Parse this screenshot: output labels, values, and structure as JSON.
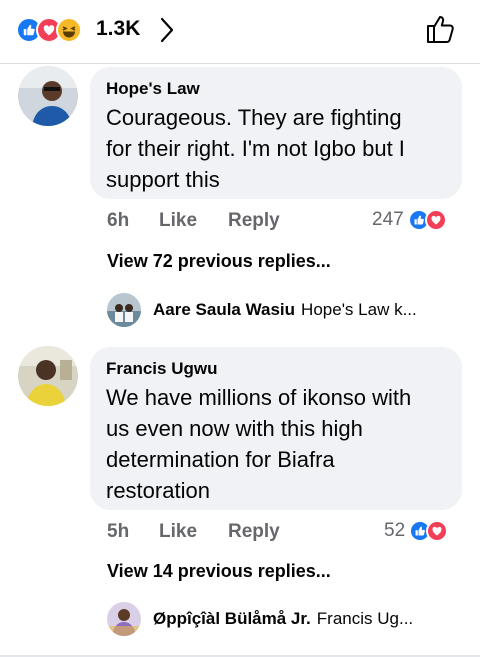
{
  "header": {
    "reaction_icons": [
      "like-icon",
      "love-icon",
      "haha-icon"
    ],
    "reaction_count": "1.3K",
    "chevron_icon": "chevron-right-icon",
    "like_button_icon": "thumbs-up-outline-icon"
  },
  "comments": [
    {
      "author": "Hope's Law",
      "text_lines": [
        "Courageous. They are fighting",
        "for their right.  I'm not Igbo but I",
        "support this"
      ],
      "time": "6h",
      "like_label": "Like",
      "reply_label": "Reply",
      "reaction_count": "247",
      "view_replies": "View 72 previous replies...",
      "reply_preview": {
        "author": "Aare Saula Wasiu",
        "text": "Hope's Law k..."
      }
    },
    {
      "author": "Francis Ugwu",
      "text_lines": [
        "We have millions of ikonso with",
        "us even now with this high",
        "determination for Biafra",
        "restoration"
      ],
      "time": "5h",
      "like_label": "Like",
      "reply_label": "Reply",
      "reaction_count": "52",
      "view_replies": "View 14 previous replies...",
      "reply_preview": {
        "author": "Øppîçîàl Bülåmå Jr.",
        "text": "Francis Ug..."
      }
    }
  ],
  "colors": {
    "like_blue": "#1877f2",
    "love_red": "#f33e58",
    "haha_yellow": "#f7b928",
    "bubble_gray": "#f0f2f5",
    "meta_gray": "#65676b"
  }
}
